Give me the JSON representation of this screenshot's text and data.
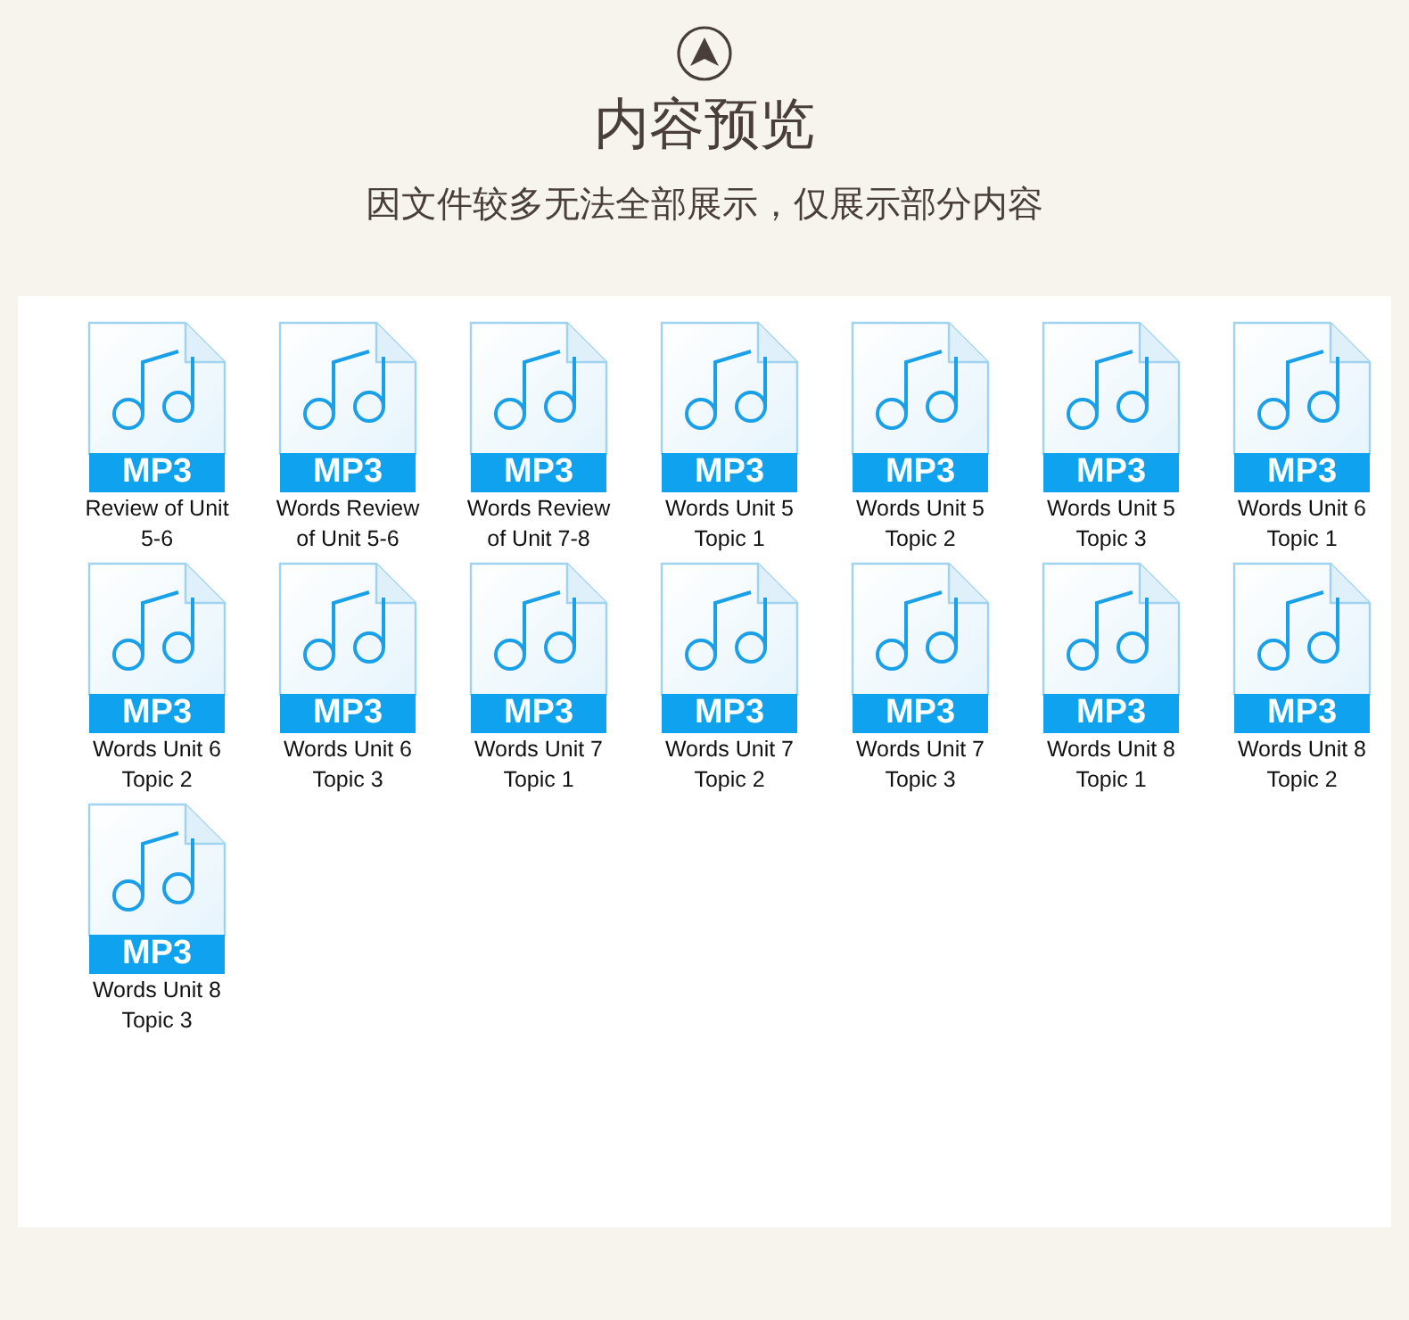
{
  "header": {
    "title": "内容预览",
    "subtitle": "因文件较多无法全部展示，仅展示部分内容"
  },
  "files": [
    {
      "name": "Review of Unit 5-6",
      "type_label": "MP3"
    },
    {
      "name": "Words Review of Unit 5-6",
      "type_label": "MP3"
    },
    {
      "name": "Words Review of Unit 7-8",
      "type_label": "MP3"
    },
    {
      "name": "Words Unit 5 Topic 1",
      "type_label": "MP3"
    },
    {
      "name": "Words Unit 5 Topic 2",
      "type_label": "MP3"
    },
    {
      "name": "Words Unit 5 Topic 3",
      "type_label": "MP3"
    },
    {
      "name": "Words Unit 6 Topic 1",
      "type_label": "MP3"
    },
    {
      "name": "Words Unit 6 Topic 2",
      "type_label": "MP3"
    },
    {
      "name": "Words Unit 6 Topic 3",
      "type_label": "MP3"
    },
    {
      "name": "Words Unit 7 Topic 1",
      "type_label": "MP3"
    },
    {
      "name": "Words Unit 7 Topic 2",
      "type_label": "MP3"
    },
    {
      "name": "Words Unit 7 Topic 3",
      "type_label": "MP3"
    },
    {
      "name": "Words Unit 8 Topic 1",
      "type_label": "MP3"
    },
    {
      "name": "Words Unit 8 Topic 2",
      "type_label": "MP3"
    },
    {
      "name": "Words Unit 8 Topic 3",
      "type_label": "MP3"
    }
  ]
}
